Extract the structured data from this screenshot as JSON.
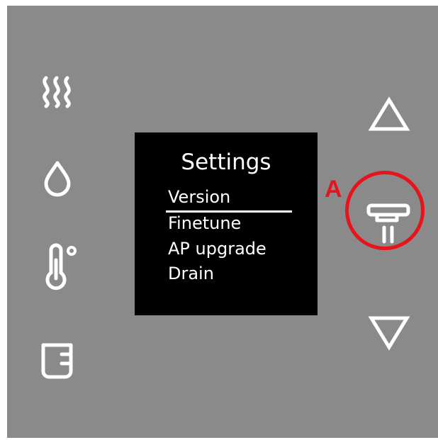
{
  "screen": {
    "title": "Settings",
    "menu_items": [
      "Version",
      "Finetune",
      "AP upgrade",
      "Drain"
    ],
    "selected_index": 0
  },
  "annotation": {
    "label": "A",
    "color": "#e8141b"
  },
  "left_icons": [
    "steam-icon",
    "water-drop-icon",
    "thermometer-icon",
    "cup-icon"
  ],
  "right_buttons": [
    "up-arrow-icon",
    "dispense-icon",
    "down-arrow-icon"
  ],
  "colors": {
    "panel": "#8a8a8a",
    "screen": "#000000",
    "foreground": "#ffffff",
    "accent": "#e8141b"
  }
}
